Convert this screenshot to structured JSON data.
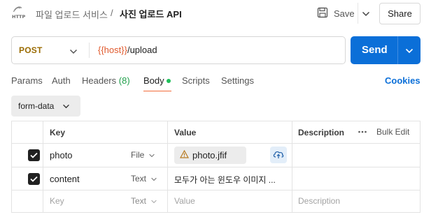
{
  "breadcrumb": {
    "icon": "http-icon",
    "parent": "파일 업로드 서비스",
    "separator": "/",
    "current": "사진 업로드 API"
  },
  "toolbar": {
    "save_label": "Save",
    "share_label": "Share"
  },
  "request": {
    "method": "POST",
    "url_variable": "{{host}}",
    "url_path": "/upload",
    "send_label": "Send"
  },
  "tabs": {
    "params": "Params",
    "auth": "Auth",
    "headers": "Headers",
    "headers_count": "(8)",
    "body": "Body",
    "scripts": "Scripts",
    "settings": "Settings",
    "active": "Body",
    "cookies": "Cookies"
  },
  "body": {
    "mode": "form-data",
    "columns": {
      "key": "Key",
      "value": "Value",
      "description": "Description",
      "bulk_edit": "Bulk Edit"
    },
    "rows": [
      {
        "checked": true,
        "key": "photo",
        "type": "File",
        "value": "photo.jfif"
      },
      {
        "checked": true,
        "key": "content",
        "type": "Text",
        "value": "모두가 아는 윈도우 이미지 ..."
      }
    ],
    "placeholder": {
      "key": "Key",
      "type": "Text",
      "value": "Value",
      "description": "Description"
    }
  },
  "colors": {
    "accent": "#0b6fd8",
    "method": "#9a6b00",
    "url_variable": "#e05a2d",
    "headers_count": "#1f9f4a",
    "body_dot": "#1fbf5a",
    "active_tab_underline": "#f26b3a"
  }
}
